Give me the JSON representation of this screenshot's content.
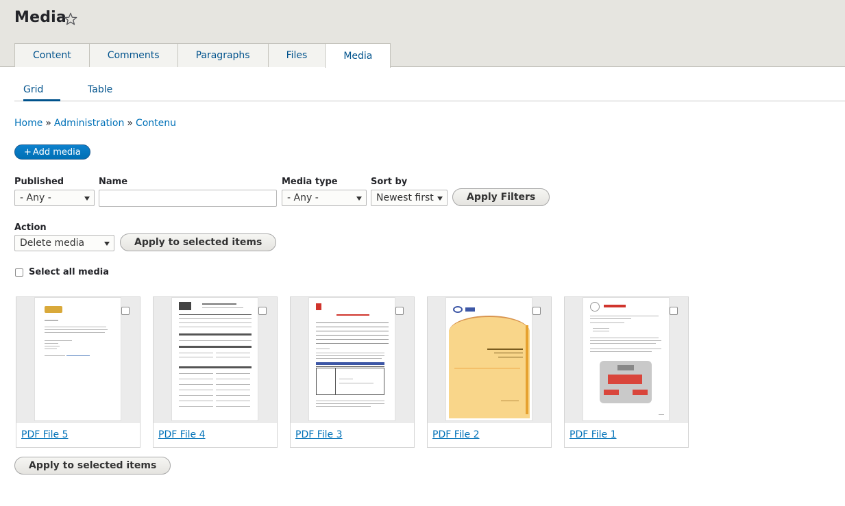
{
  "header": {
    "title": "Media",
    "tabs": [
      {
        "label": "Content",
        "active": false
      },
      {
        "label": "Comments",
        "active": false
      },
      {
        "label": "Paragraphs",
        "active": false
      },
      {
        "label": "Files",
        "active": false
      },
      {
        "label": "Media",
        "active": true
      }
    ]
  },
  "subtabs": [
    {
      "label": "Grid",
      "active": true
    },
    {
      "label": "Table",
      "active": false
    }
  ],
  "breadcrumb": {
    "items": [
      "Home",
      "Administration",
      "Contenu"
    ],
    "separator": "»"
  },
  "add_media": {
    "plus": "+",
    "label": "Add media"
  },
  "filters": {
    "published": {
      "label": "Published",
      "value": "- Any -"
    },
    "name": {
      "label": "Name",
      "value": ""
    },
    "media_type": {
      "label": "Media type",
      "value": "- Any -"
    },
    "sort_by": {
      "label": "Sort by",
      "value": "Newest first"
    },
    "apply_label": "Apply Filters"
  },
  "action": {
    "label": "Action",
    "value": "Delete media",
    "apply_label": "Apply to selected items"
  },
  "select_all": {
    "label": "Select all media"
  },
  "media_items": [
    {
      "title": "PDF File 5"
    },
    {
      "title": "PDF File 4"
    },
    {
      "title": "PDF File 3"
    },
    {
      "title": "PDF File 2"
    },
    {
      "title": "PDF File 1"
    }
  ],
  "bottom_apply_label": "Apply to selected items",
  "colors": {
    "link": "#0071b8",
    "tab_link": "#00528c",
    "primary_button": "#0071b8",
    "header_bg": "#e6e5e0"
  }
}
